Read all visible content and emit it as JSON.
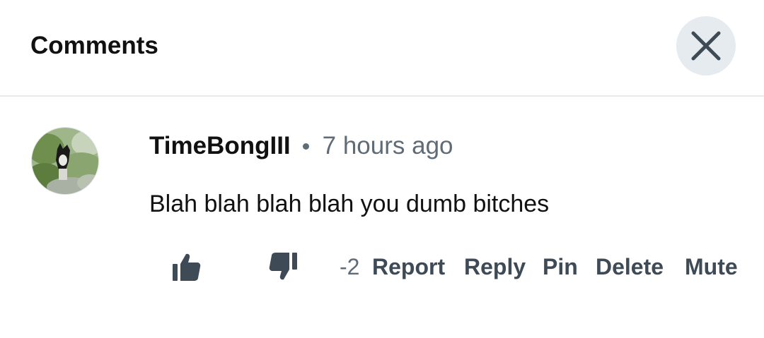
{
  "header": {
    "title": "Comments",
    "close_icon": "close-icon"
  },
  "comment": {
    "username": "TimeBongIII",
    "timestamp": "7 hours ago",
    "text": "Blah blah blah blah you dumb bitches",
    "score": "-2",
    "avatar_icon": "user-avatar-dog-photo"
  },
  "actions": {
    "like_icon": "thumbs-up-icon",
    "dislike_icon": "thumbs-down-icon",
    "report_label": "Report",
    "reply_label": "Reply",
    "pin_label": "Pin",
    "delete_label": "Delete",
    "mute_label": "Mute"
  },
  "colors": {
    "text_primary": "#111111",
    "text_secondary": "#5f6b76",
    "action": "#3e4a56",
    "close_bg": "#e6ebf0",
    "divider": "#e6e9ec"
  }
}
